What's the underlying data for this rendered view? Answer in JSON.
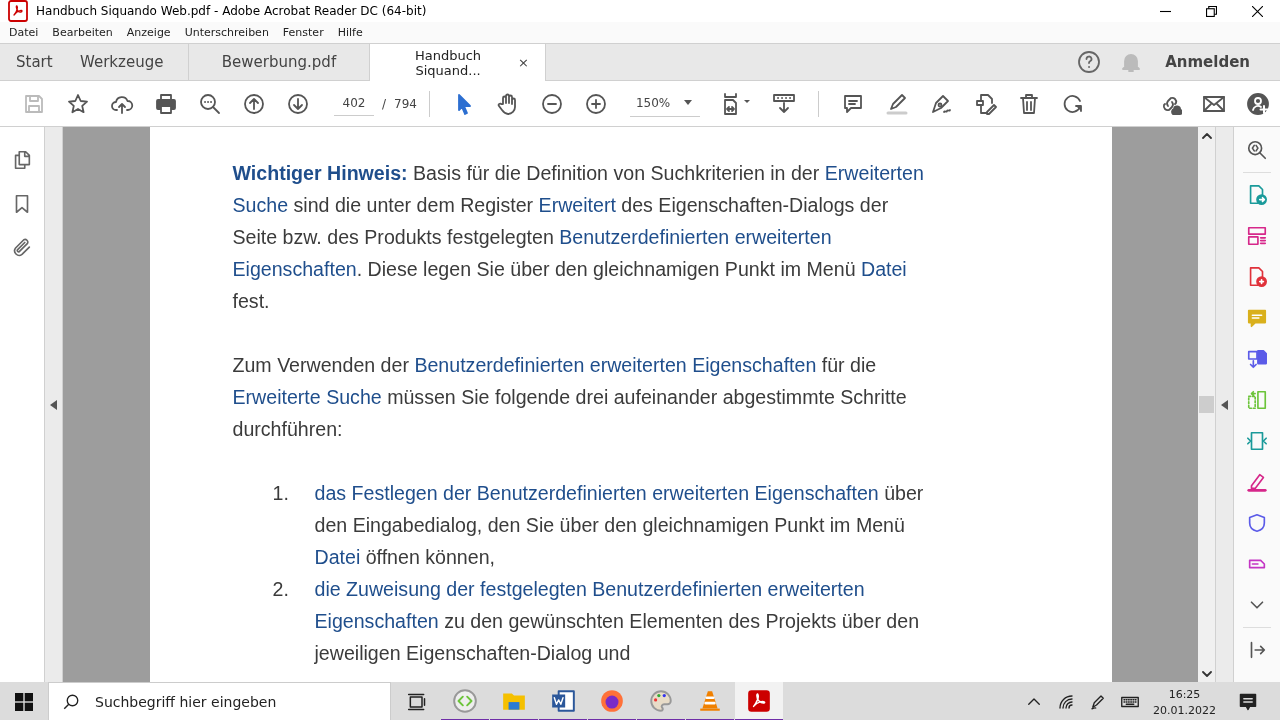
{
  "window": {
    "title": "Handbuch Siquando Web.pdf - Adobe Acrobat Reader DC (64-bit)"
  },
  "menu": [
    "Datei",
    "Bearbeiten",
    "Anzeige",
    "Unterschreiben",
    "Fenster",
    "Hilfe"
  ],
  "tabs": [
    {
      "label": "Start",
      "selected": false
    },
    {
      "label": "Werkzeuge",
      "selected": false
    },
    {
      "label": "Bewerbung.pdf",
      "selected": false
    },
    {
      "label": "Handbuch Siquand...",
      "selected": true,
      "close": "×"
    }
  ],
  "header_actions": {
    "sign_in": "Anmelden"
  },
  "toolbar": {
    "left_tools": [
      {
        "kind": "save",
        "disabled": true
      },
      {
        "kind": "star",
        "disabled": false
      },
      {
        "kind": "upload",
        "disabled": false
      },
      {
        "kind": "print",
        "disabled": false
      },
      {
        "kind": "find",
        "disabled": false
      },
      {
        "kind": "up",
        "disabled": false
      },
      {
        "kind": "down",
        "disabled": false
      }
    ],
    "page_number": "402",
    "page_separator": "/",
    "page_count": "794",
    "view_tools": [
      {
        "kind": "pointer",
        "selected": true
      },
      {
        "kind": "hand",
        "selected": false
      },
      {
        "kind": "zoom_out",
        "selected": false
      },
      {
        "kind": "zoom_in",
        "selected": false
      }
    ],
    "zoom": "150%",
    "edit_tools": [
      {
        "kind": "comment"
      },
      {
        "kind": "highlight"
      },
      {
        "kind": "sign"
      },
      {
        "kind": "edit"
      },
      {
        "kind": "trash"
      },
      {
        "kind": "rotate"
      }
    ]
  },
  "document": {
    "blocks": [
      {
        "kind": "paragraph",
        "lines": [
          [
            {
              "kind": "bold_link",
              "text": "Wichtiger Hinweis:"
            },
            {
              "kind": "plain",
              "text": " Basis für die Definition von Suchkriterien in der "
            },
            {
              "kind": "link",
              "text": "Erweiterten"
            }
          ],
          [
            {
              "kind": "link",
              "text": "Suche"
            },
            {
              "kind": "plain",
              "text": " sind die unter dem Register "
            },
            {
              "kind": "link",
              "text": "Erweitert"
            },
            {
              "kind": "plain",
              "text": " des Eigenschaften-Dialogs der"
            }
          ],
          [
            {
              "kind": "plain",
              "text": "Seite bzw. des Produkts festgelegten "
            },
            {
              "kind": "link",
              "text": "Benutzerdefinierten erweiterten"
            }
          ],
          [
            {
              "kind": "link",
              "text": "Eigenschaften"
            },
            {
              "kind": "plain",
              "text": ". Diese legen Sie über den gleichnamigen Punkt im Menü "
            },
            {
              "kind": "link",
              "text": "Datei"
            }
          ],
          [
            {
              "kind": "plain",
              "text": "fest."
            }
          ]
        ]
      },
      {
        "kind": "paragraph",
        "lines": [
          [
            {
              "kind": "plain",
              "text": "Zum Verwenden der "
            },
            {
              "kind": "link",
              "text": "Benutzerdefinierten erweiterten Eigenschaften"
            },
            {
              "kind": "plain",
              "text": " für die"
            }
          ],
          [
            {
              "kind": "link",
              "text": "Erweiterte Suche"
            },
            {
              "kind": "plain",
              "text": " müssen Sie folgende drei aufeinander abgestimmte Schritte"
            }
          ],
          [
            {
              "kind": "plain",
              "text": "durchführen:"
            }
          ]
        ]
      },
      {
        "kind": "item",
        "number": "1.",
        "lines": [
          [
            {
              "kind": "link",
              "text": "das Festlegen der Benutzerdefinierten erweiterten Eigenschaften"
            },
            {
              "kind": "plain",
              "text": " über"
            }
          ],
          [
            {
              "kind": "plain",
              "text": "den Eingabedialog, den Sie über den gleichnamigen Punkt im Menü"
            }
          ],
          [
            {
              "kind": "link",
              "text": "Datei"
            },
            {
              "kind": "plain",
              "text": " öffnen können,"
            }
          ]
        ]
      },
      {
        "kind": "item",
        "number": "2.",
        "lines": [
          [
            {
              "kind": "link",
              "text": "die Zuweisung der festgelegten Benutzerdefinierten erweiterten"
            }
          ],
          [
            {
              "kind": "link",
              "text": "Eigenschaften"
            },
            {
              "kind": "plain",
              "text": " zu den gewünschten Elementen des Projekts über den"
            }
          ],
          [
            {
              "kind": "plain",
              "text": "jeweiligen Eigenschaften-Dialog und"
            }
          ]
        ]
      }
    ]
  },
  "right_tools": [
    {
      "kind": "export",
      "color": "#1a9a9a"
    },
    {
      "kind": "organize",
      "color": "#d6278a"
    },
    {
      "kind": "create",
      "color": "#e0313a"
    },
    {
      "kind": "note",
      "color": "#d9b01c"
    },
    {
      "kind": "combine",
      "color": "#5b5be8"
    },
    {
      "kind": "compress",
      "color": "#6cc43a"
    },
    {
      "kind": "scan",
      "color": "#1a9a9a"
    },
    {
      "kind": "fill",
      "color": "#d6278a"
    },
    {
      "kind": "protect",
      "color": "#5b5be8"
    },
    {
      "kind": "more",
      "color": "#c435c4"
    }
  ],
  "taskbar": {
    "search": {
      "placeholder": "Suchbegriff hier eingeben"
    },
    "apps": [
      {
        "kind": "code",
        "running": true,
        "selected": false
      },
      {
        "kind": "files",
        "running": true,
        "selected": false
      },
      {
        "kind": "word",
        "running": true,
        "selected": false
      },
      {
        "kind": "browser",
        "running": true,
        "selected": false
      },
      {
        "kind": "paint",
        "running": true,
        "selected": false
      },
      {
        "kind": "cone",
        "running": true,
        "selected": false
      },
      {
        "kind": "acrobat",
        "running": true,
        "selected": true
      }
    ],
    "time": "16:25",
    "date": "20.01.2022"
  }
}
